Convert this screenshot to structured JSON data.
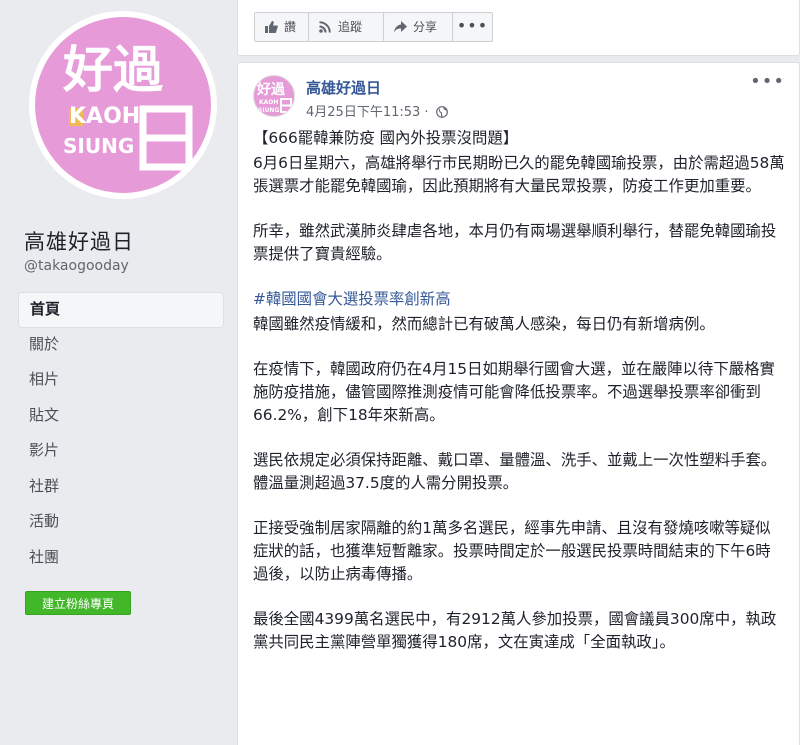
{
  "page": {
    "name": "高雄好過日",
    "handle": "@takaogooday",
    "logo": {
      "big_text": "好過",
      "cell_text": "日",
      "kaoh": "KAOH",
      "siung": "SIUNG",
      "bg_color": "#e69ad8",
      "accent_color": "#f2c03e"
    }
  },
  "nav": {
    "items": [
      {
        "label": "首頁",
        "active": true
      },
      {
        "label": "關於"
      },
      {
        "label": "相片"
      },
      {
        "label": "貼文"
      },
      {
        "label": "影片"
      },
      {
        "label": "社群"
      },
      {
        "label": "活動"
      },
      {
        "label": "社團"
      }
    ],
    "cta_label": "建立粉絲專頁"
  },
  "actions": {
    "like_label": "讚",
    "follow_label": "追蹤",
    "share_label": "分享",
    "more_label": "•••",
    "like_icon": "thumbs-up-icon",
    "follow_icon": "rss-icon",
    "share_icon": "share-arrow-icon"
  },
  "post": {
    "author": "高雄好過日",
    "time": "4月25日下午11:53 ·",
    "privacy_icon": "globe-icon",
    "menu_label": "•••",
    "title": "【666罷韓兼防疫 國內外投票沒問題】",
    "paragraphs": [
      "6月6日星期六，高雄將舉行市民期盼已久的罷免韓國瑜投票，由於需超過58萬張選票才能罷免韓國瑜，因此預期將有大量民眾投票，防疫工作更加重要。",
      "所幸，雖然武漢肺炎肆虐各地，本月仍有兩場選舉順利舉行，替罷免韓國瑜投票提供了寶貴經驗。"
    ],
    "hashtag": "#韓國國會大選投票率創新高",
    "paragraphs2": [
      "韓國雖然疫情緩和，然而總計已有破萬人感染，每日仍有新增病例。",
      "在疫情下，韓國政府仍在4月15日如期舉行國會大選，並在嚴陣以待下嚴格實施防疫措施，儘管國際推測疫情可能會降低投票率。不過選舉投票率卻衝到66.2%，創下18年來新高。",
      "選民依規定必須保持距離、戴口罩、量體溫、洗手、並戴上一次性塑料手套。體溫量測超過37.5度的人需分開投票。",
      "正接受強制居家隔離的約1萬多名選民，經事先申請、且沒有發燒咳嗽等疑似症狀的話，也獲準短暫離家。投票時間定於一般選民投票時間結束的下午6時過後，以防止病毒傳播。",
      "最後全國4399萬名選民中，有2912萬人參加投票，國會議員300席中，執政黨共同民主黨陣營單獨獲得180席，文在寅達成「全面執政」。"
    ]
  }
}
